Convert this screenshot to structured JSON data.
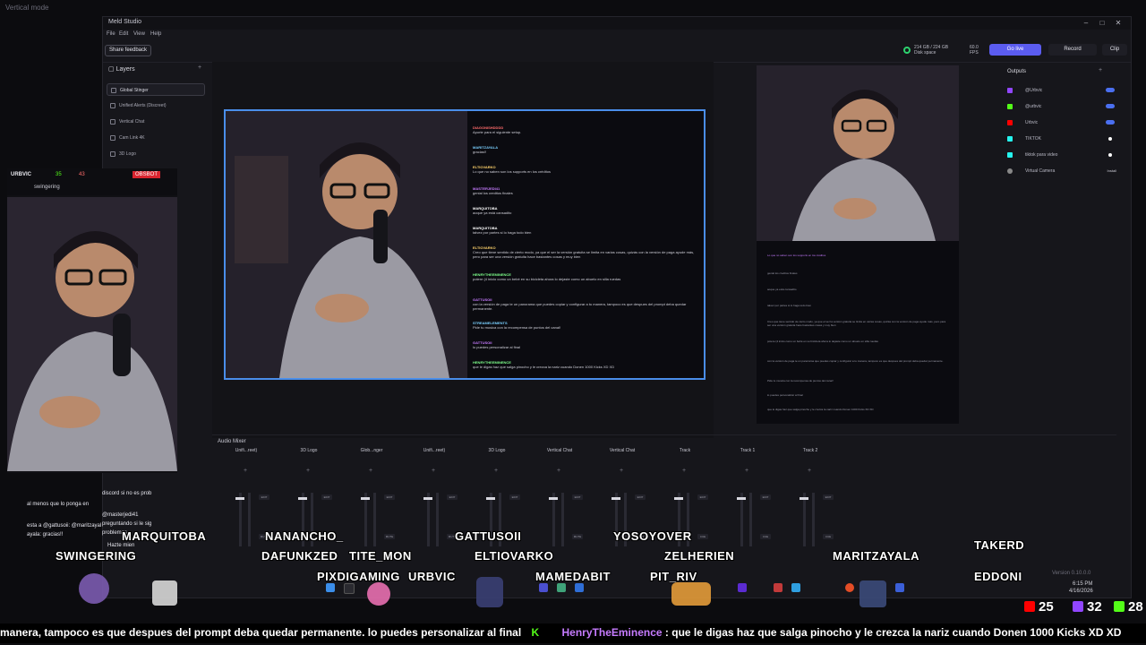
{
  "desktop": {
    "label": "Vertical mode"
  },
  "app": {
    "title": "Meld Studio",
    "menu": [
      "File",
      "Edit",
      "View",
      "Help"
    ],
    "share_feedback": "Share feedback",
    "disk": {
      "line1": "214 GB / 224 GB",
      "line2": "Disk space"
    },
    "fps": {
      "line1": "60.0",
      "line2": "FPS"
    },
    "go_live": "Go live",
    "record": "Record",
    "clip": "Clip"
  },
  "layers": {
    "title": "Layers",
    "items": [
      "Global Stinger",
      "Unified Alerts (Discreet)",
      "Vertical Chat",
      "Cam Link 4K",
      "3D Logo"
    ]
  },
  "chat": [
    {
      "user": "DIAGONISHDDDD",
      "color": "#ff6b6b",
      "text": "Aporte para el siguiente setup."
    },
    {
      "user": "MARITZAYALA",
      "color": "#7ad0ff",
      "text": "gracias!!"
    },
    {
      "user": "ELTIOVARKO",
      "color": "#ffd36b",
      "text": "Lo que no saben son los supports en los créditos"
    },
    {
      "user": "MASTERJEDI41",
      "color": "#c67bff",
      "text": "genial los creditos finales"
    },
    {
      "user": "MARQUITOBA",
      "color": "#ffffff",
      "text": "aoque ya está cansadito"
    },
    {
      "user": "MARQUITOBA",
      "color": "#ffffff",
      "text": "talvez por partes si lo haga todo bien"
    },
    {
      "user": "ELTIOVARKO",
      "color": "#ffd36b",
      "text": "Creo que tiene sentido de cierto modo, ya que el ser la versión gratuita se limita en varias cosas, quizás con la versión de paga ayude más, pero para ser una versión gratuita hace bastantes cosas y muy bien"
    },
    {
      "user": "HENRYTHEEMINENCE",
      "color": "#7dff8a",
      "text": "potere (4 inicio como un bebé en su bicicleta ahora lo dejaste como un abuelo en silla ruedas"
    },
    {
      "user": "GATTUSOII",
      "color": "#c67bff",
      "text": "con la versión de paga te un panorama que puedes copiar y configurar a tu manera, tampoco es que despues del prompt deba quedar permanente."
    },
    {
      "user": "STREAMELEMENTS",
      "color": "#7ad0ff",
      "text": "Pide tu musica con la recompensa de puntos del canal!"
    },
    {
      "user": "GATTUSOII",
      "color": "#c67bff",
      "text": "lo puedes personalizar al final"
    },
    {
      "user": "HENRYTHEEMINENCE",
      "color": "#7dff8a",
      "text": "que le digas haz que salga pinocho y le crezca la nariz cuando Donen 1000 Kicks XD XD"
    }
  ],
  "outputs": {
    "title": "Outputs",
    "items": [
      {
        "name": "@Urbvic",
        "icon_color": "#9146ff",
        "state": "on"
      },
      {
        "name": "@urbvic",
        "icon_color": "#53fc18",
        "state": "on"
      },
      {
        "name": "Urbvic",
        "icon_color": "#ff0000",
        "state": "on"
      },
      {
        "name": "TIKTOK",
        "icon_color": "#25f4ee",
        "state": "dot"
      },
      {
        "name": "tiktok para video",
        "icon_color": "#25f4ee",
        "state": "dot"
      },
      {
        "name": "Virtual Camera",
        "icon_color": "#888888",
        "state": "Install"
      }
    ]
  },
  "mixer": {
    "title": "Audio Mixer",
    "channels": [
      "Unifi...reet)",
      "3D Logo",
      "Glob...nger",
      "Unifi...reet)",
      "3D Logo",
      "Vertical Chat",
      "Vertical Chat",
      "Track",
      "Track 1",
      "Track 2"
    ],
    "edit": "EDIT",
    "mute": "MUTE",
    "cue": "CUE"
  },
  "cam": {
    "channel": "URBVIC",
    "count1": "35",
    "count2": "43",
    "badge": "OBSBOT",
    "sub": "swingering"
  },
  "bottom_chat": [
    "discord si no es prob",
    "al menos que lo ponga en",
    "@masterjedi41",
    "esta a @gattusoii: @maritzayal",
    "preguntando si le sig",
    "ayala: gracias!!",
    "problemas",
    "Hazte mien"
  ],
  "names": [
    "MARQUITOBA",
    "NANANCHO_",
    "GATTUSOII",
    "YOSOYOVER",
    "TAKERD",
    "SWINGERING",
    "DAFUNKZED",
    "TITE_MON",
    "ELTIOVARKO",
    "ZELHERIEN",
    "MARITZAYALA",
    "PIXDIGAMING",
    "URBVIC",
    "MAMEDABIT",
    "PIT_RIV",
    "EDDONI"
  ],
  "ticker": {
    "prefix": "manera, tampoco es que despues del prompt deba quedar permanente.  lo puedes personalizar al final",
    "user": "HenryTheEminence",
    "message": ":  que le digas haz que salga pinocho y le crezca la nariz cuando Donen 1000 Kicks XD XD"
  },
  "counters": {
    "youtube": "25",
    "twitch": "32",
    "kick": "28"
  },
  "clock": {
    "time": "6:15 PM",
    "date": "4/16/2026"
  },
  "version": "Version 0.10.0.0"
}
